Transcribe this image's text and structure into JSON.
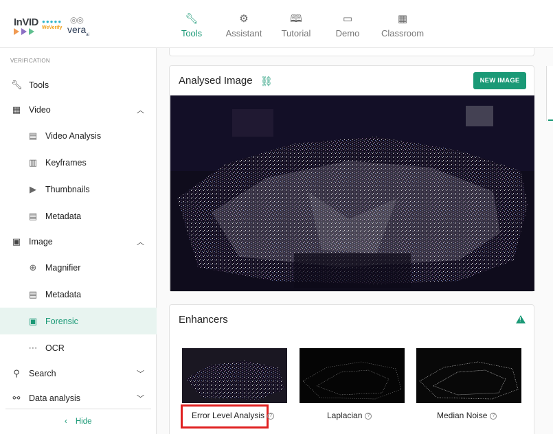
{
  "logos": {
    "invid": "InVID",
    "weverify": "WeVerify",
    "vera": "vera",
    "vera_suffix": "ai"
  },
  "nav": [
    {
      "label": "Tools",
      "icon": "wrench-icon",
      "active": true
    },
    {
      "label": "Assistant",
      "icon": "robot-icon",
      "active": false
    },
    {
      "label": "Tutorial",
      "icon": "book-icon",
      "active": false
    },
    {
      "label": "Demo",
      "icon": "gamepad-icon",
      "active": false
    },
    {
      "label": "Classroom",
      "icon": "classroom-icon",
      "active": false
    }
  ],
  "sidebar": {
    "section_label": "VERIFICATION",
    "items": [
      {
        "label": "Tools",
        "icon": "wrench-icon"
      },
      {
        "label": "Video",
        "icon": "film-icon",
        "expanded": true
      },
      {
        "label": "Video Analysis",
        "icon": "film-strip-icon"
      },
      {
        "label": "Keyframes",
        "icon": "keyframes-icon"
      },
      {
        "label": "Thumbnails",
        "icon": "youtube-icon"
      },
      {
        "label": "Metadata",
        "icon": "document-icon"
      },
      {
        "label": "Image",
        "icon": "image-icon",
        "expanded": true
      },
      {
        "label": "Magnifier",
        "icon": "magnifier-icon"
      },
      {
        "label": "Metadata",
        "icon": "document-icon"
      },
      {
        "label": "Forensic",
        "icon": "forensic-icon",
        "active": true
      },
      {
        "label": "OCR",
        "icon": "ocr-icon"
      },
      {
        "label": "Search",
        "icon": "search-icon",
        "expanded": false
      },
      {
        "label": "Data analysis",
        "icon": "graph-icon",
        "expanded": false
      }
    ],
    "hide_label": "Hide"
  },
  "analysed": {
    "title": "Analysed Image",
    "new_image_label": "NEW IMAGE"
  },
  "enhancers": {
    "title": "Enhancers",
    "items": [
      {
        "label": "Error Level Analysis",
        "highlighted": true
      },
      {
        "label": "Laplacian"
      },
      {
        "label": "Median Noise"
      }
    ]
  },
  "colors": {
    "accent": "#1a9976",
    "highlight": "#e02020"
  }
}
